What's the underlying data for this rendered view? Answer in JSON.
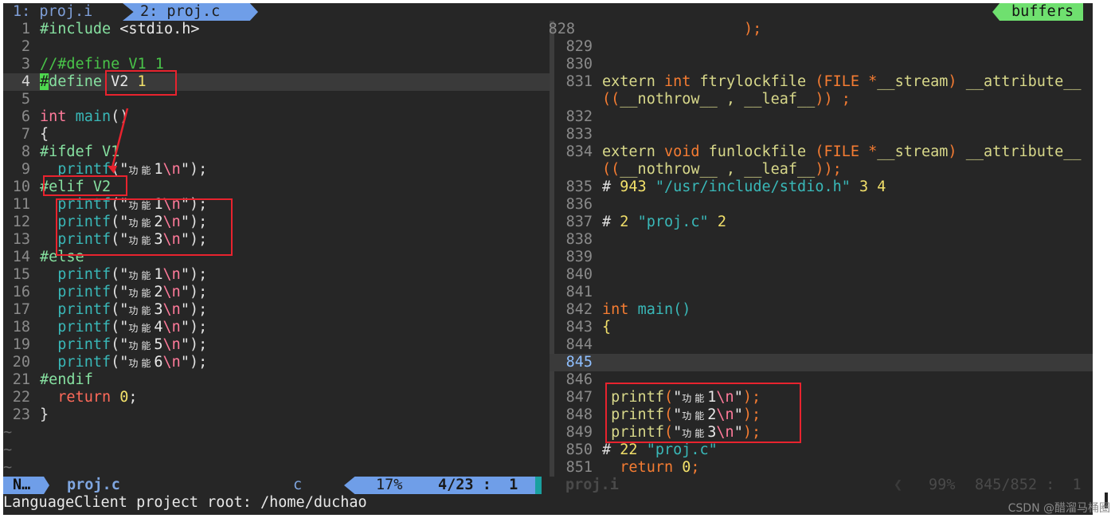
{
  "tabline": {
    "tab1": "1: proj.i",
    "tab2": "2: proj.c",
    "buffers": "buffers"
  },
  "left_lines": [
    {
      "n": "1",
      "t": "#include <stdio.h>"
    },
    {
      "n": "2",
      "t": ""
    },
    {
      "n": "3",
      "t": "//#define V1 1"
    },
    {
      "n": "4",
      "t": "#define V2 1"
    },
    {
      "n": "5",
      "t": ""
    },
    {
      "n": "6",
      "t": "int main()"
    },
    {
      "n": "7",
      "t": "{"
    },
    {
      "n": "8",
      "t": "#ifdef V1"
    },
    {
      "n": "9",
      "t": "  printf(\"功能1\\n\");"
    },
    {
      "n": "10",
      "t": "#elif V2"
    },
    {
      "n": "11",
      "t": "  printf(\"功能1\\n\");"
    },
    {
      "n": "12",
      "t": "  printf(\"功能2\\n\");"
    },
    {
      "n": "13",
      "t": "  printf(\"功能3\\n\");"
    },
    {
      "n": "14",
      "t": "#else"
    },
    {
      "n": "15",
      "t": "  printf(\"功能1\\n\");"
    },
    {
      "n": "16",
      "t": "  printf(\"功能2\\n\");"
    },
    {
      "n": "17",
      "t": "  printf(\"功能3\\n\");"
    },
    {
      "n": "18",
      "t": "  printf(\"功能4\\n\");"
    },
    {
      "n": "19",
      "t": "  printf(\"功能5\\n\");"
    },
    {
      "n": "20",
      "t": "  printf(\"功能6\\n\");"
    },
    {
      "n": "21",
      "t": "#endif"
    },
    {
      "n": "22",
      "t": "  return 0;"
    },
    {
      "n": "23",
      "t": "}"
    },
    {
      "n": "~",
      "t": ""
    },
    {
      "n": "~",
      "t": ""
    },
    {
      "n": "~",
      "t": ""
    }
  ],
  "right_lines": [
    {
      "n": "828",
      "t": ");"
    },
    {
      "n": "829",
      "t": ""
    },
    {
      "n": "830",
      "t": ""
    },
    {
      "n": "831",
      "t": "extern int ftrylockfile (FILE *__stream) __attribute__"
    },
    {
      "n": "",
      "t": "((__nothrow__ , __leaf__)) ;"
    },
    {
      "n": "832",
      "t": ""
    },
    {
      "n": "833",
      "t": ""
    },
    {
      "n": "834",
      "t": "extern void funlockfile (FILE *__stream) __attribute__"
    },
    {
      "n": "",
      "t": "((__nothrow__ , __leaf__));"
    },
    {
      "n": "835",
      "t": "# 943 \"/usr/include/stdio.h\" 3 4"
    },
    {
      "n": "836",
      "t": ""
    },
    {
      "n": "837",
      "t": "# 2 \"proj.c\" 2"
    },
    {
      "n": "838",
      "t": ""
    },
    {
      "n": "839",
      "t": ""
    },
    {
      "n": "840",
      "t": ""
    },
    {
      "n": "841",
      "t": ""
    },
    {
      "n": "842",
      "t": "int main()"
    },
    {
      "n": "843",
      "t": "{"
    },
    {
      "n": "844",
      "t": ""
    },
    {
      "n": "845",
      "t": ""
    },
    {
      "n": "846",
      "t": ""
    },
    {
      "n": "847",
      "t": " printf(\"功能1\\n\");"
    },
    {
      "n": "848",
      "t": " printf(\"功能2\\n\");"
    },
    {
      "n": "849",
      "t": " printf(\"功能3\\n\");"
    },
    {
      "n": "850",
      "t": "# 22 \"proj.c\""
    },
    {
      "n": "851",
      "t": "  return 0;"
    }
  ],
  "status": {
    "mode": "N…",
    "filename": "proj.c",
    "filetype": "c",
    "percent": "17%",
    "position": "4/23 :  1",
    "right_filename": "proj.i",
    "right_percent": "99%",
    "right_position": "845/852 :  1"
  },
  "cmdline": "LanguageClient project root: /home/duchao",
  "watermark": "CSDN @醋溜马桶圈"
}
